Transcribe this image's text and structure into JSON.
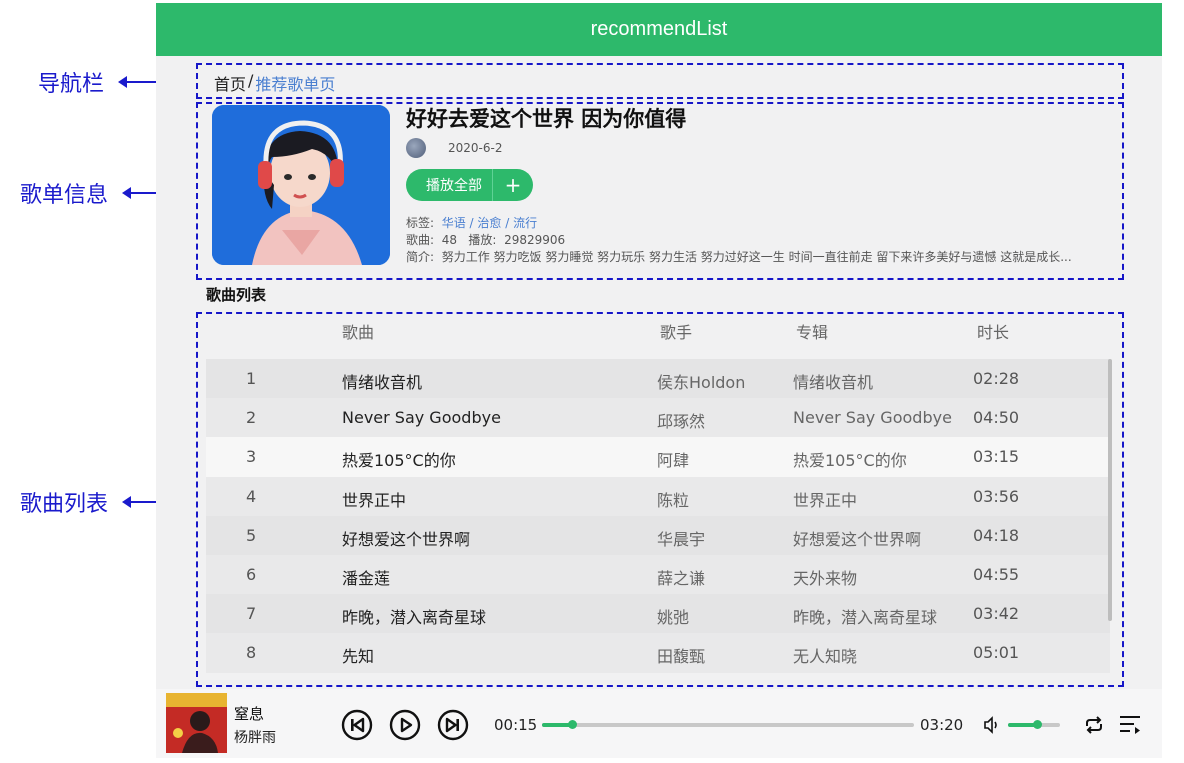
{
  "annotations": {
    "nav": "导航栏",
    "info": "歌单信息",
    "list": "歌曲列表"
  },
  "header": {
    "title": "recommendList"
  },
  "breadcrumb": {
    "home": "首页",
    "separator": "/",
    "current": "推荐歌单页"
  },
  "playlist": {
    "title": "好好去爱这个世界 因为你值得",
    "date": "2020-6-2",
    "play_all_label": "播放全部",
    "add_label": "+",
    "tags_label": "标签:",
    "tags": [
      "华语",
      "治愈",
      "流行"
    ],
    "tag_sep": "/",
    "songs_label": "歌曲:",
    "songs_count": "48",
    "plays_label": "播放:",
    "plays_count": "29829906",
    "desc_label": "简介:",
    "desc": "努力工作 努力吃饭 努力睡觉 努力玩乐 努力生活 努力过好这一生 时间一直往前走 留下来许多美好与遗憾 这就是成长..."
  },
  "song_list": {
    "title": "歌曲列表",
    "columns": {
      "song": "歌曲",
      "artist": "歌手",
      "album": "专辑",
      "duration": "时长"
    },
    "rows": [
      {
        "no": "1",
        "song": "情绪收音机",
        "artist": "侯东Holdon",
        "album": "情绪收音机",
        "duration": "02:28"
      },
      {
        "no": "2",
        "song": "Never Say Goodbye",
        "artist": "邱琢然",
        "album": "Never Say Goodbye",
        "duration": "04:50"
      },
      {
        "no": "3",
        "song": "热爱105°C的你",
        "artist": "阿肆",
        "album": "热爱105°C的你",
        "duration": "03:15"
      },
      {
        "no": "4",
        "song": "世界正中",
        "artist": "陈粒",
        "album": "世界正中",
        "duration": "03:56"
      },
      {
        "no": "5",
        "song": "好想爱这个世界啊",
        "artist": "华晨宇",
        "album": "好想爱这个世界啊",
        "duration": "04:18"
      },
      {
        "no": "6",
        "song": "潘金莲",
        "artist": "薛之谦",
        "album": "天外来物",
        "duration": "04:55"
      },
      {
        "no": "7",
        "song": "昨晚，潜入离奇星球",
        "artist": "姚弛",
        "album": "昨晚，潜入离奇星球",
        "duration": "03:42"
      },
      {
        "no": "8",
        "song": "先知",
        "artist": "田馥甄",
        "album": "无人知晓",
        "duration": "05:01"
      }
    ],
    "highlighted_row": 2
  },
  "player": {
    "song_title": "窒息",
    "artist": "杨胖雨",
    "current_time": "00:15",
    "total_time": "03:20",
    "progress_fraction": 0.08,
    "volume_fraction": 0.55,
    "accent_color": "#2db96b",
    "icons": [
      "prev-icon",
      "play-icon",
      "next-icon",
      "volume-icon",
      "loop-icon",
      "playlist-icon"
    ]
  }
}
